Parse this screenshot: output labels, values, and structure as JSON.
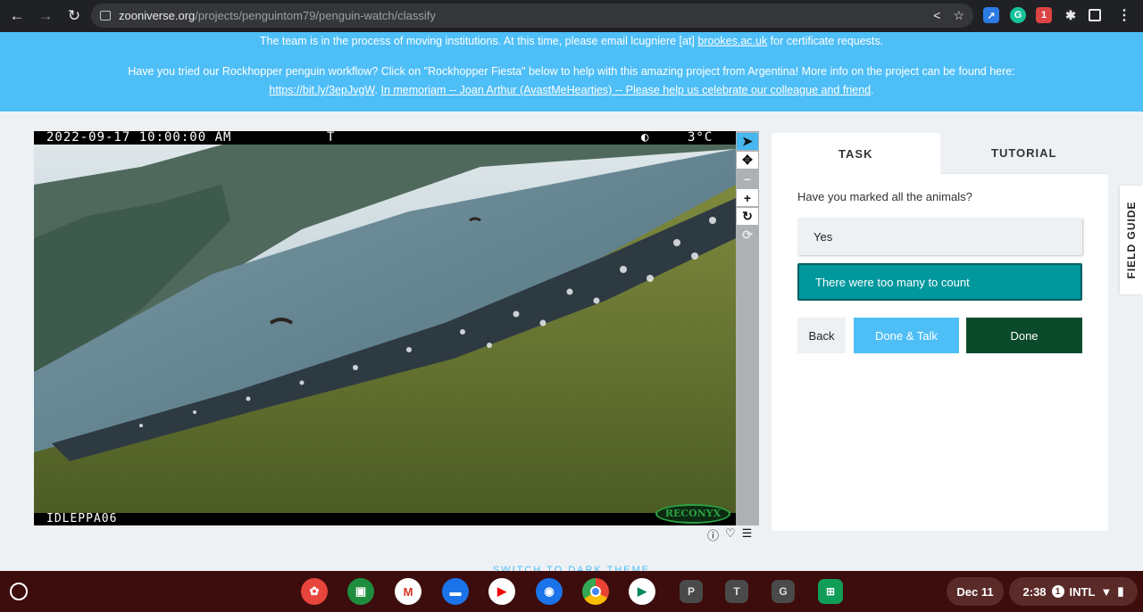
{
  "browser": {
    "url_host": "zooniverse.org",
    "url_path": "/projects/penguintom79/penguin-watch/classify"
  },
  "banner": {
    "line1_prefix": "The team is in the process of moving institutions. At this time, please email lcugniere [at] ",
    "line1_link": "brookes.ac.uk",
    "line1_suffix": " for certificate requests.",
    "line2": "Have you tried our Rockhopper penguin workflow? Click on \"Rockhopper Fiesta\" below to help with this amazing project from Argentina! More info on the project can be found here:",
    "line3_link1": "https://bit.ly/3epJvgW",
    "line3_sep": ". ",
    "line3_link2": "In memoriam -- Joan Arthur (AvastMeHearties) -- Please help us celebrate our colleague and friend",
    "line3_end": "."
  },
  "camera": {
    "datetime": "2022-09-17 10:00:00 AM",
    "flag": "T",
    "moon_icon": "moon-phase-icon",
    "temperature": "3°C",
    "camera_id": "IDLEPPA06",
    "brand": "RECONYX"
  },
  "viewer_tools": [
    {
      "name": "pointer-tool",
      "glyph": "➤",
      "active": true
    },
    {
      "name": "pan-tool",
      "glyph": "✥",
      "active": false
    },
    {
      "name": "zoom-out-tool",
      "glyph": "−",
      "active": false,
      "dim": true
    },
    {
      "name": "zoom-in-tool",
      "glyph": "+",
      "active": false
    },
    {
      "name": "rotate-tool",
      "glyph": "↻",
      "active": false
    },
    {
      "name": "reset-tool",
      "glyph": "⟳",
      "active": false,
      "dim": true
    }
  ],
  "meta_icons": [
    "info-icon",
    "favorite-icon",
    "collections-icon"
  ],
  "task_panel": {
    "tab_task": "TASK",
    "tab_tutorial": "TUTORIAL",
    "question": "Have you marked all the animals?",
    "answer_yes": "Yes",
    "answer_many": "There were too many to count",
    "back_label": "Back",
    "done_talk_label": "Done & Talk",
    "done_label": "Done"
  },
  "field_guide_label": "FIELD GUIDE",
  "dark_theme_label": "SWITCH TO DARK THEME",
  "shelf": {
    "apps": [
      "palette-app-icon",
      "classroom-app-icon",
      "gmail-app-icon",
      "files-app-icon",
      "youtube-app-icon",
      "camera-app-icon",
      "chrome-app-icon",
      "play-store-app-icon"
    ],
    "letter_apps": [
      "P",
      "T",
      "G"
    ],
    "date": "Dec 11",
    "time": "2:38",
    "notification_count": "1",
    "input_method": "INTL"
  }
}
